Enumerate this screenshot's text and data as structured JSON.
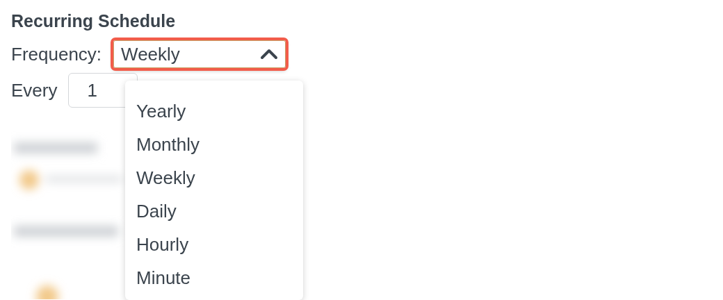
{
  "section_title": "Recurring Schedule",
  "frequency": {
    "label": "Frequency:",
    "value": "Weekly",
    "expanded": true,
    "highlighted": true
  },
  "every": {
    "label": "Every",
    "value": "1"
  },
  "frequency_options": [
    {
      "label": "Yearly",
      "selected": false
    },
    {
      "label": "Monthly",
      "selected": false
    },
    {
      "label": "Weekly",
      "selected": false
    },
    {
      "label": "Daily",
      "selected": false
    },
    {
      "label": "Hourly",
      "selected": false
    },
    {
      "label": "Minute",
      "selected": false
    }
  ]
}
